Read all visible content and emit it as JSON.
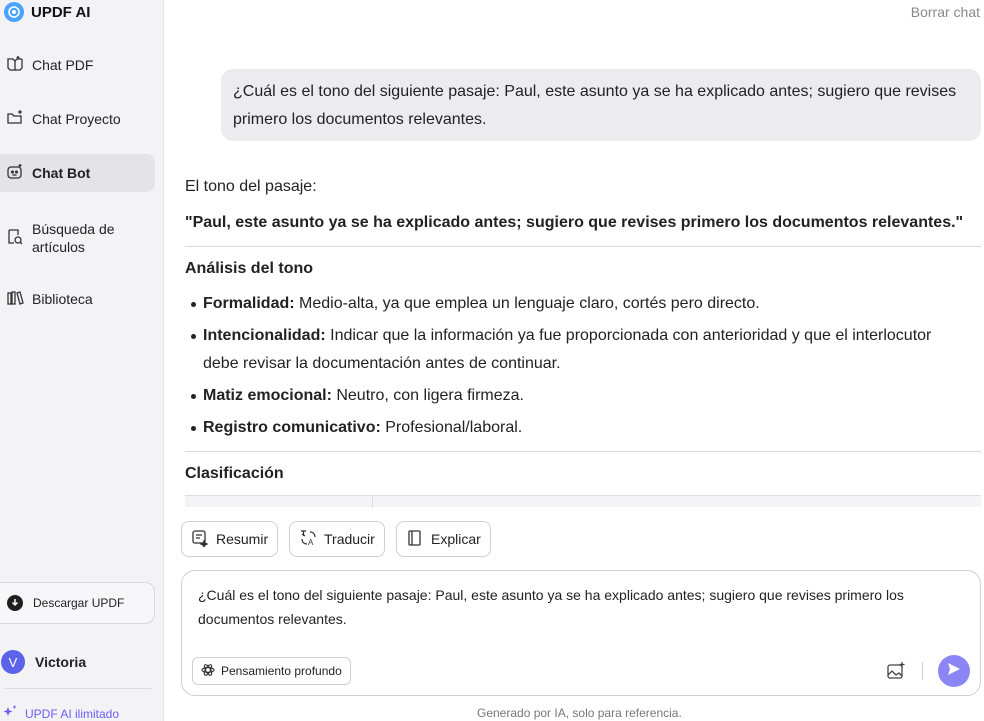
{
  "app": {
    "brand": "UPDF AI"
  },
  "sidebar": {
    "items": [
      {
        "label": "Chat PDF",
        "icon": "book-chat-icon"
      },
      {
        "label": "Chat Proyecto",
        "icon": "folder-plus-icon"
      },
      {
        "label": "Chat Bot",
        "icon": "bot-icon",
        "active": true
      },
      {
        "label": "Búsqueda de artículos",
        "icon": "doc-search-icon"
      },
      {
        "label": "Biblioteca",
        "icon": "library-icon"
      }
    ],
    "download_label": "Descargar UPDF",
    "user_initial": "V",
    "user_name": "Victoria",
    "unlimited_label": "UPDF AI ilimitado"
  },
  "header": {
    "clear_chat": "Borrar chat"
  },
  "chat": {
    "user_message": "¿Cuál es el tono del siguiente pasaje: Paul, este asunto ya se ha explicado antes; sugiero que revises primero los documentos relevantes.",
    "answer": {
      "intro": "El tono del pasaje:",
      "quote": "\"Paul, este asunto ya se ha explicado antes; sugiero que revises primero los documentos relevantes.\"",
      "analysis_heading": "Análisis del tono",
      "bullets": [
        {
          "term": "Formalidad:",
          "text": " Medio-alta, ya que emplea un lenguaje claro, cortés pero directo."
        },
        {
          "term": "Intencionalidad:",
          "text": " Indicar que la información ya fue proporcionada con anterioridad y que el interlocutor debe revisar la documentación antes de continuar."
        },
        {
          "term": "Matiz emocional:",
          "text": " Neutro, con ligera firmeza."
        },
        {
          "term": "Registro comunicativo:",
          "text": " Profesional/laboral."
        }
      ],
      "classification_heading": "Clasificación"
    }
  },
  "actions": {
    "summarize": "Resumir",
    "translate": "Traducir",
    "explain": "Explicar"
  },
  "composer": {
    "text": "¿Cuál es el tono del siguiente pasaje: Paul, este asunto ya se ha explicado antes; sugiero que revises primero los documentos relevantes.",
    "deep_thinking": "Pensamiento profundo"
  },
  "footer": {
    "disclaimer": "Generado por IA, solo para referencia."
  },
  "colors": {
    "accent": "#8b85f5",
    "brand": "#4aa3ff",
    "unlimited": "#6b5cf5"
  }
}
